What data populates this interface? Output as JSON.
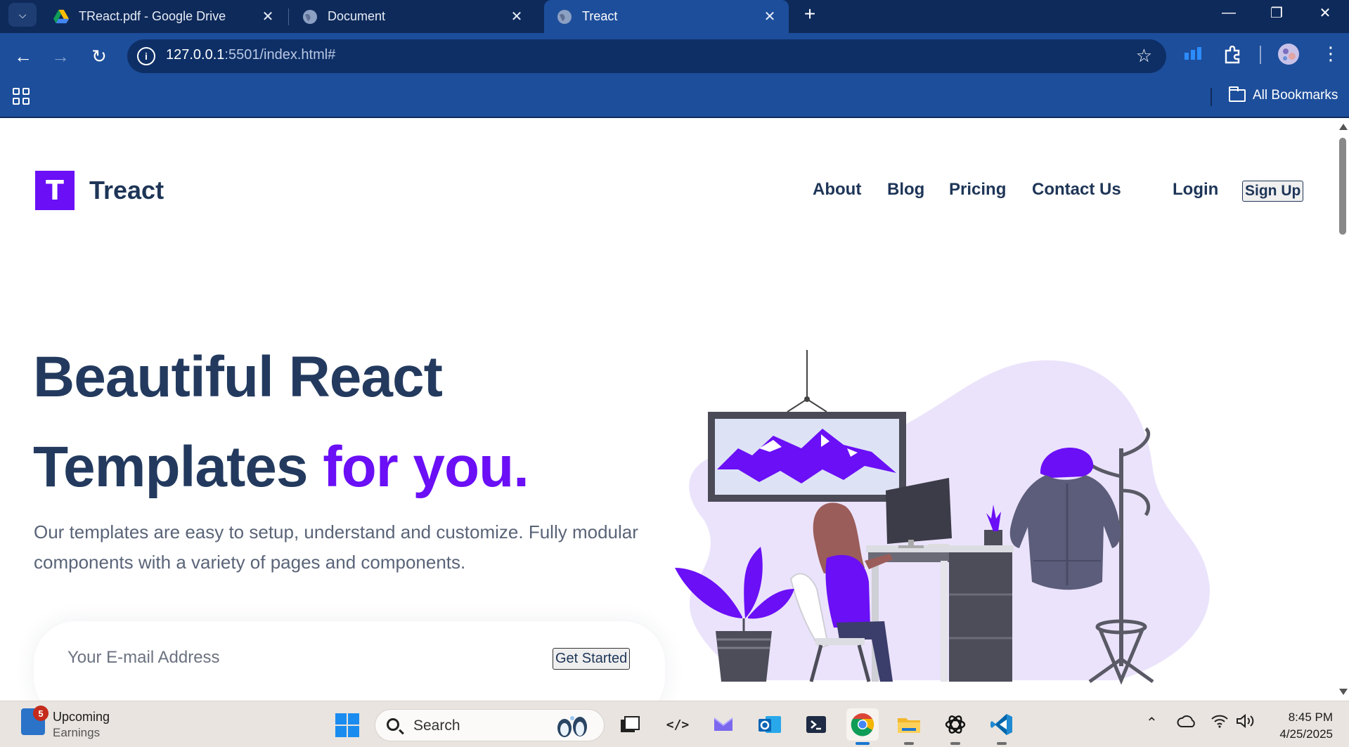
{
  "browser": {
    "tabs": [
      {
        "title": "TReact.pdf - Google Drive",
        "favicon": "google-drive-icon"
      },
      {
        "title": "Document",
        "favicon": "globe-icon"
      },
      {
        "title": "Treact",
        "favicon": "globe-icon",
        "active": true
      }
    ],
    "url_host": "127.0.0.1",
    "url_rest": ":5501/index.html#",
    "bookmarks_label": "All Bookmarks"
  },
  "site": {
    "logo_letter": "T",
    "brand": "Treact",
    "nav": [
      "About",
      "Blog",
      "Pricing",
      "Contact Us"
    ],
    "login": "Login",
    "signup": "Sign Up",
    "hero": {
      "line1": "Beautiful React",
      "line2_a": "Templates ",
      "line2_b": "for you.",
      "subtitle": "Our templates are easy to setup, understand and customize. Fully modular components with a variety of pages and components.",
      "email_placeholder": "Your E-mail Address",
      "cta": "Get Started"
    },
    "accent_color": "#6a0ff6",
    "heading_color": "#233a5e"
  },
  "taskbar": {
    "widget_badge": "5",
    "widget_title": "Upcoming",
    "widget_subtitle": "Earnings",
    "search_label": "Search",
    "time": "8:45 PM",
    "date": "4/25/2025"
  }
}
